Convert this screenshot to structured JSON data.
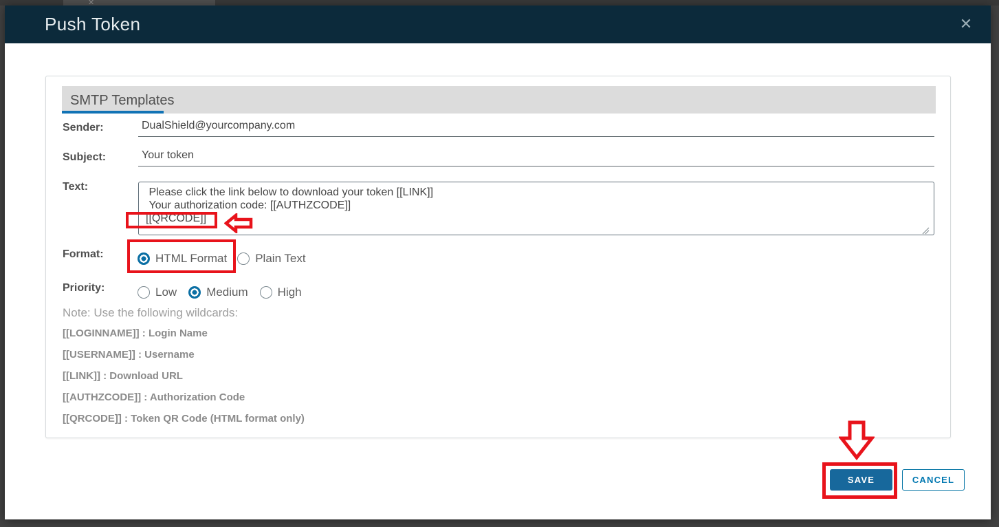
{
  "background": {
    "tab_close_glyph": "✕"
  },
  "modal": {
    "title": "Push Token",
    "close_glyph": "✕"
  },
  "tab": {
    "label": "SMTP Templates"
  },
  "form": {
    "sender": {
      "label": "Sender:",
      "value": "DualShield@yourcompany.com"
    },
    "subject": {
      "label": "Subject:",
      "value": "Your token"
    },
    "text": {
      "label": "Text:",
      "value": " Please click the link below to download your token [[LINK]]\n Your authorization code: [[AUTHZCODE]]\n[[QRCODE]]"
    },
    "format": {
      "label": "Format:",
      "options": [
        {
          "label": "HTML Format",
          "selected": true
        },
        {
          "label": "Plain Text",
          "selected": false
        }
      ]
    },
    "priority": {
      "label": "Priority:",
      "options": [
        {
          "label": "Low",
          "selected": false
        },
        {
          "label": "Medium",
          "selected": true
        },
        {
          "label": "High",
          "selected": false
        }
      ]
    },
    "note": "Note: Use the following wildcards:",
    "wildcards": [
      "[[LOGINNAME]] : Login Name",
      "[[USERNAME]] : Username",
      "[[LINK]] : Download URL",
      "[[AUTHZCODE]] : Authorization Code",
      "[[QRCODE]] : Token QR Code (HTML format only)"
    ]
  },
  "buttons": {
    "save": "SAVE",
    "cancel": "CANCEL"
  },
  "colors": {
    "header_bg": "#0c2a3b",
    "accent_blue": "#1173b5",
    "save_blue": "#17689c",
    "annotation_red": "#e8131b"
  }
}
